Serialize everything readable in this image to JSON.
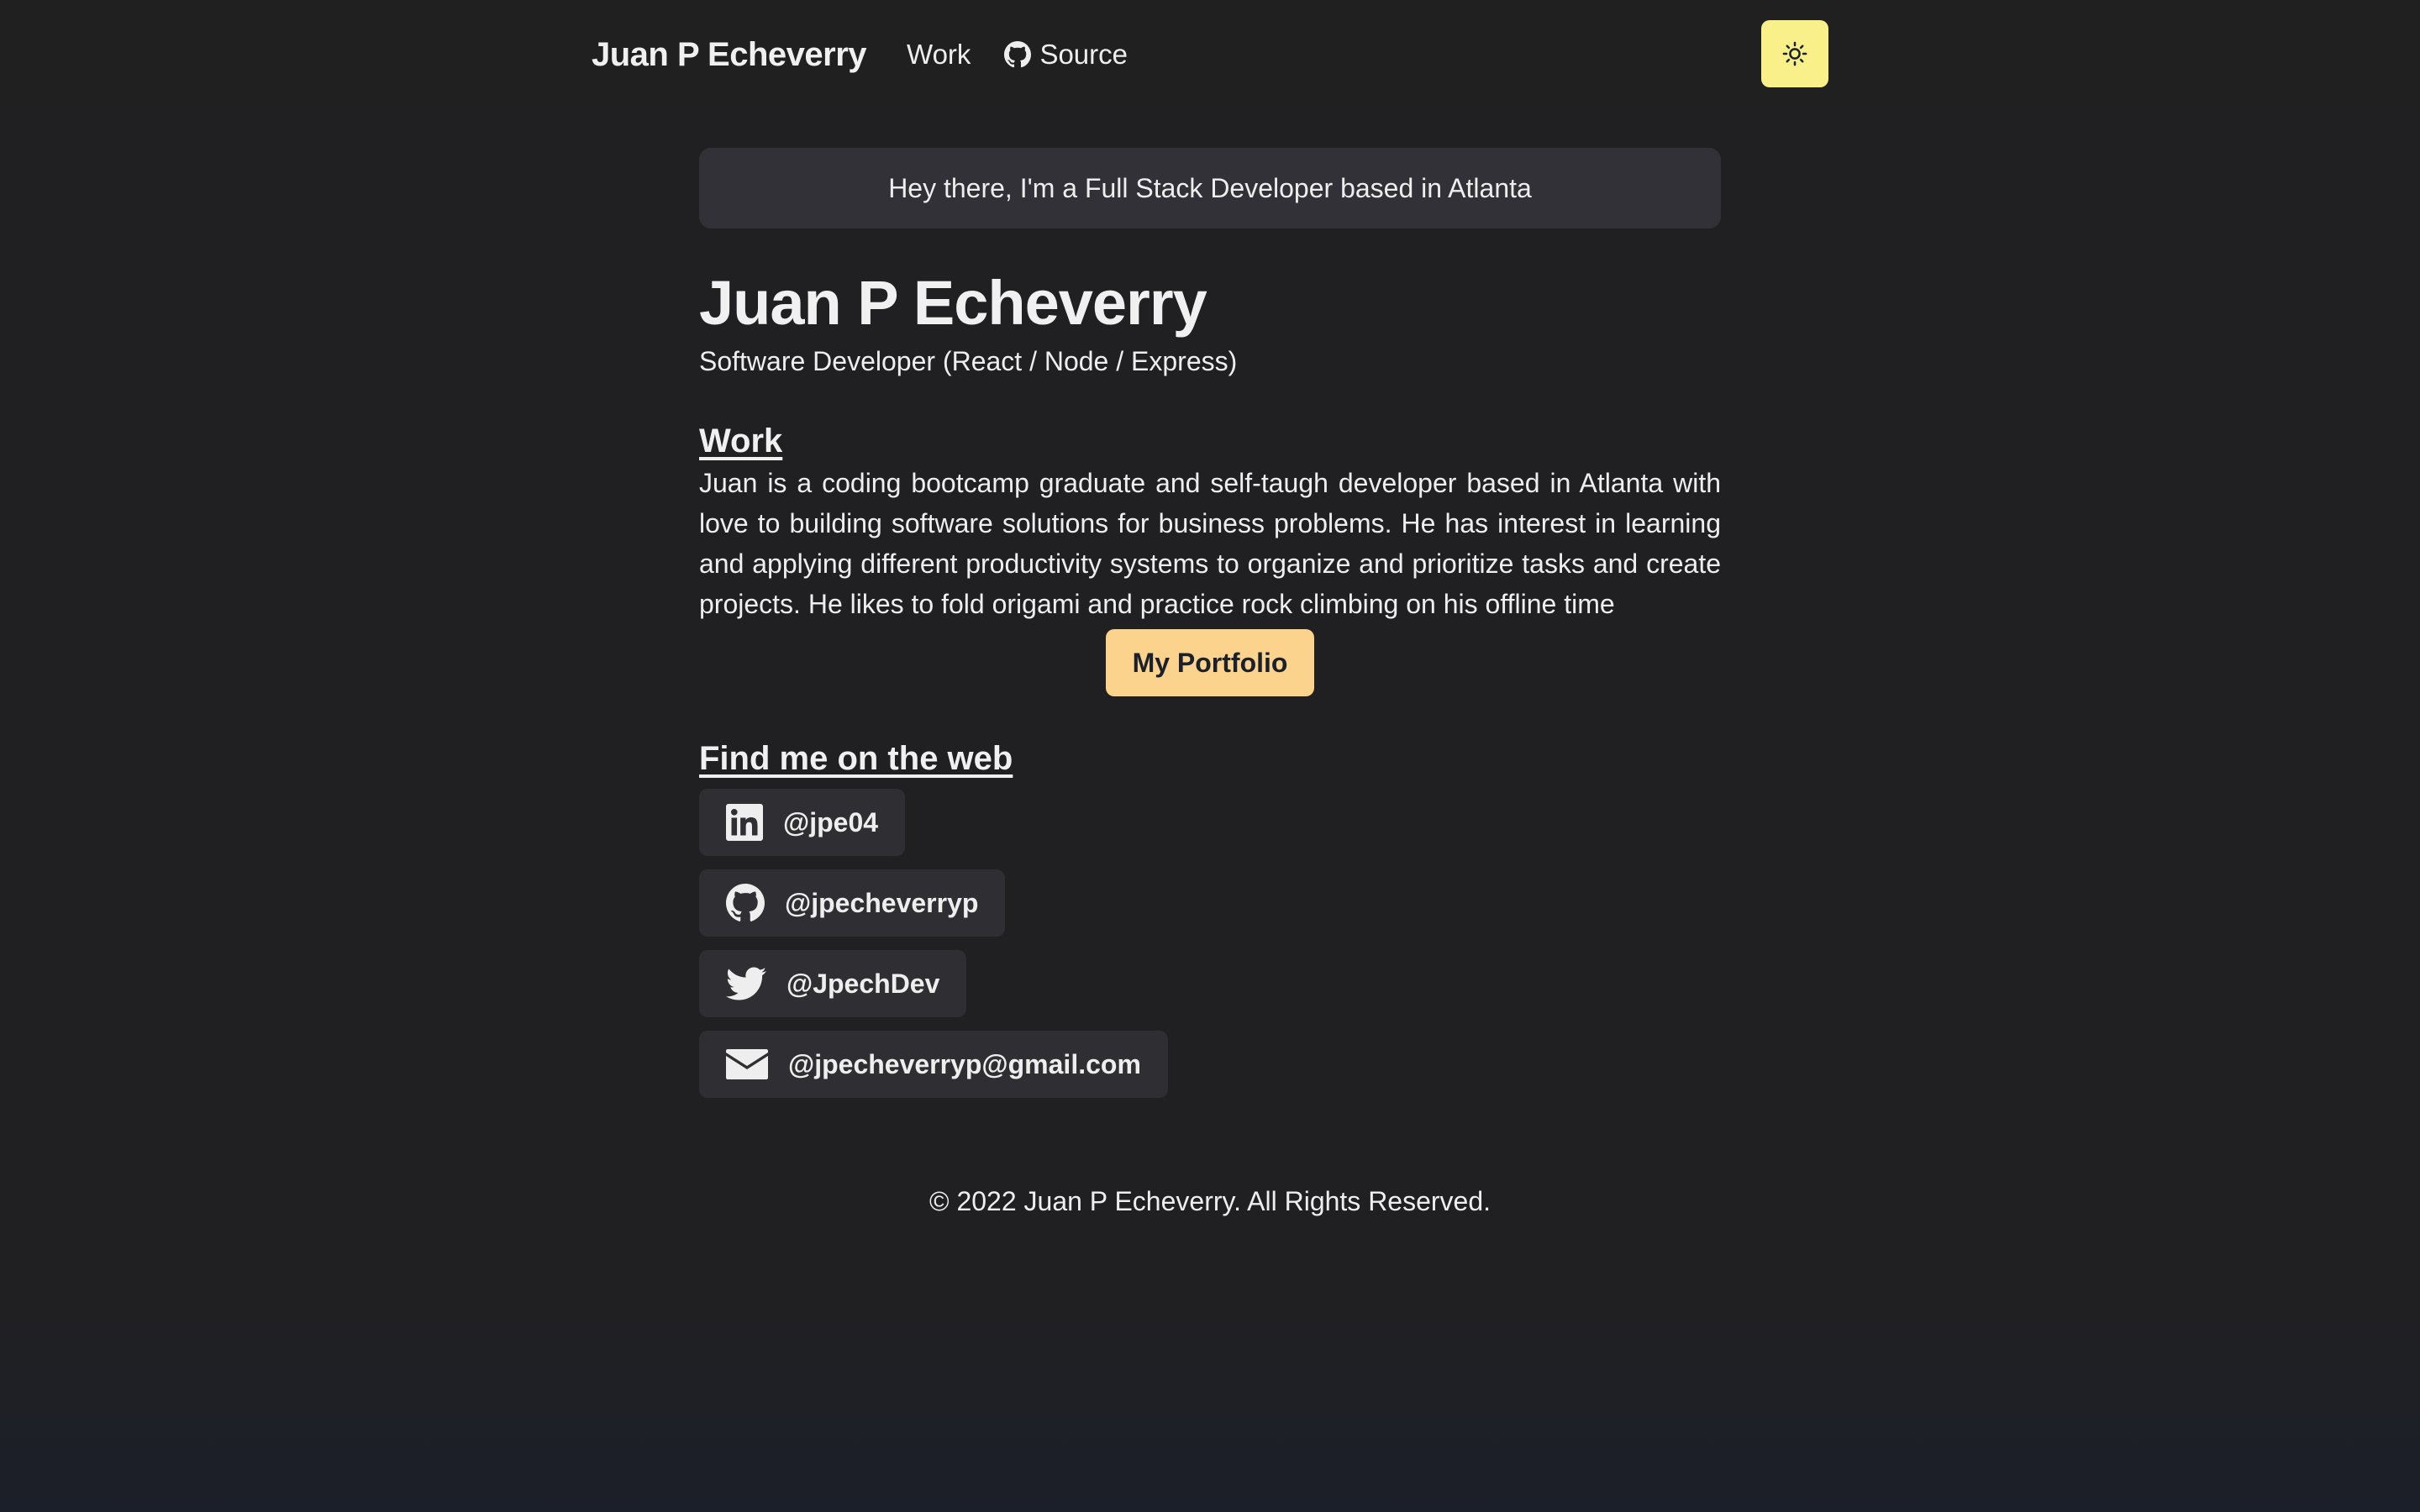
{
  "navbar": {
    "brand": "Juan P Echeverry",
    "links": [
      {
        "label": "Work"
      },
      {
        "label": "Source",
        "icon": "github-icon"
      }
    ],
    "theme_toggle_icon": "sun-icon"
  },
  "greeting": "Hey there, I'm a Full Stack Developer based in Atlanta",
  "profile": {
    "name": "Juan P Echeverry",
    "role": "Software Developer (React / Node / Express)"
  },
  "work": {
    "heading": "Work",
    "bio": "Juan is a coding bootcamp graduate and self-taugh developer based in Atlanta with love to building software solutions for business problems. He has interest in learning and applying different productivity systems to organize and prioritize tasks and create projects. He likes to fold origami and practice rock climbing on his offline time",
    "portfolio_label": "My Portfolio"
  },
  "web": {
    "heading": "Find me on the web",
    "links": [
      {
        "icon": "linkedin-icon",
        "label": "@jpe04"
      },
      {
        "icon": "github-icon",
        "label": "@jpecheverryp"
      },
      {
        "icon": "twitter-icon",
        "label": "@JpechDev"
      },
      {
        "icon": "mail-icon",
        "label": "@jpecheverryp@gmail.com"
      }
    ]
  },
  "footer": "© 2022 Juan P Echeverry. All Rights Reserved.",
  "colors": {
    "background": "#202023",
    "navbar": "#202020",
    "accent_toggle": "#faf089",
    "accent_button": "#fbd38d",
    "card": "#313137"
  }
}
